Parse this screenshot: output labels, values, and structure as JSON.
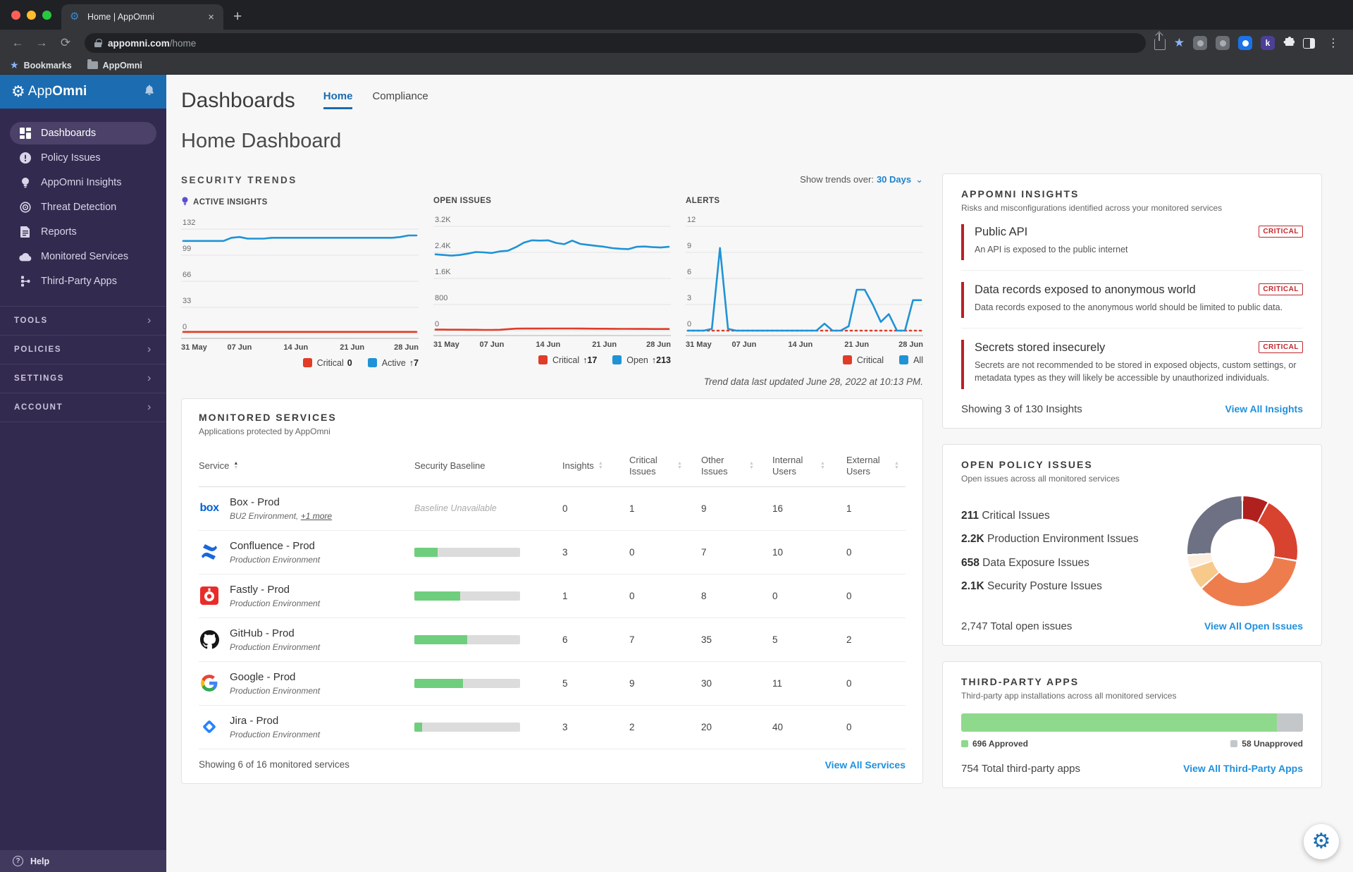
{
  "icons": {
    "back": "←",
    "forward": "→",
    "reload": "⟳",
    "menu": "⋮",
    "plus": "+",
    "close": "×",
    "chevron_down": "⌄",
    "chevron_right": "›",
    "gear": "⚙",
    "star": "★",
    "sort_up": "▲",
    "sort_down": "▼",
    "puzzle": "⬡",
    "k_ext": "k"
  },
  "browser": {
    "tab_title": "Home | AppOmni",
    "url_host": "appomni.com",
    "url_path": "/home",
    "bookmarks_label": "Bookmarks",
    "bookmarks_folder": "AppOmni"
  },
  "sidebar": {
    "logo_prefix": "App",
    "logo_suffix": "Omni",
    "nav": [
      {
        "label": "Dashboards",
        "icon": "dashboards-icon",
        "active": true
      },
      {
        "label": "Policy Issues",
        "icon": "policy-issues-icon",
        "active": false
      },
      {
        "label": "AppOmni Insights",
        "icon": "insights-icon",
        "active": false
      },
      {
        "label": "Threat Detection",
        "icon": "threat-detection-icon",
        "active": false
      },
      {
        "label": "Reports",
        "icon": "reports-icon",
        "active": false
      },
      {
        "label": "Monitored Services",
        "icon": "monitored-services-icon",
        "active": false
      },
      {
        "label": "Third-Party Apps",
        "icon": "third-party-apps-icon",
        "active": false
      }
    ],
    "sections": [
      "TOOLS",
      "POLICIES",
      "SETTINGS",
      "ACCOUNT"
    ],
    "help_label": "Help"
  },
  "header": {
    "title": "Dashboards",
    "tabs": [
      {
        "label": "Home",
        "active": true
      },
      {
        "label": "Compliance",
        "active": false
      }
    ],
    "page_title": "Home Dashboard"
  },
  "trends": {
    "section_title": "SECURITY TRENDS",
    "show_label": "Show trends over:",
    "show_value": "30 Days",
    "updated_note": "Trend data last updated June 28, 2022 at 10:13 PM."
  },
  "chart_data": [
    {
      "type": "line",
      "title": "ACTIVE INSIGHTS",
      "has_bulb_icon": true,
      "ymax": 132,
      "yticks": [
        "132",
        "99",
        "66",
        "33",
        "0"
      ],
      "xticks": [
        "31 May",
        "07 Jun",
        "14 Jun",
        "21 Jun",
        "28 Jun"
      ],
      "series": [
        {
          "name": "Critical",
          "color": "#e03c28",
          "delta": "0",
          "dashed": false,
          "values": [
            2,
            2,
            2,
            2,
            2,
            2,
            2,
            2,
            2,
            2,
            2,
            2,
            2,
            2,
            2,
            2,
            2,
            2,
            2,
            2,
            2,
            2,
            2,
            2,
            2,
            2,
            2,
            2,
            2,
            2
          ]
        },
        {
          "name": "Active",
          "color": "#1f93d6",
          "delta": "↑7",
          "dashed": false,
          "values": [
            117,
            117,
            117,
            117,
            117,
            117,
            121,
            122,
            120,
            120,
            120,
            121,
            121,
            121,
            121,
            121,
            121,
            121,
            121,
            121,
            121,
            121,
            121,
            121,
            121,
            121,
            121,
            122,
            124,
            124
          ]
        }
      ]
    },
    {
      "type": "line",
      "title": "OPEN ISSUES",
      "has_bulb_icon": false,
      "ymax": 3200,
      "yticks": [
        "3.2K",
        "2.4K",
        "1.6K",
        "800",
        "0"
      ],
      "xticks": [
        "31 May",
        "07 Jun",
        "14 Jun",
        "21 Jun",
        "28 Jun"
      ],
      "series": [
        {
          "name": "Critical",
          "color": "#e03c28",
          "delta": "↑17",
          "dashed": false,
          "values": [
            30,
            30,
            28,
            28,
            26,
            25,
            22,
            22,
            25,
            45,
            60,
            62,
            62,
            62,
            64,
            64,
            64,
            64,
            62,
            60,
            58,
            58,
            56,
            55,
            54,
            52,
            52,
            50,
            50,
            50
          ]
        },
        {
          "name": "Open",
          "color": "#1f93d6",
          "delta": "↑213",
          "dashed": false,
          "values": [
            2340,
            2320,
            2300,
            2320,
            2360,
            2410,
            2400,
            2380,
            2430,
            2450,
            2560,
            2700,
            2770,
            2760,
            2770,
            2690,
            2650,
            2760,
            2660,
            2630,
            2600,
            2570,
            2530,
            2510,
            2500,
            2570,
            2580,
            2560,
            2550,
            2570
          ]
        }
      ]
    },
    {
      "type": "line",
      "title": "ALERTS",
      "has_bulb_icon": false,
      "ymax": 12,
      "yticks": [
        "12",
        "9",
        "6",
        "3",
        "0"
      ],
      "xticks": [
        "31 May",
        "07 Jun",
        "14 Jun",
        "21 Jun",
        "28 Jun"
      ],
      "series": [
        {
          "name": "Critical",
          "color": "#e03c28",
          "delta": "",
          "dashed": true,
          "values": [
            0,
            0,
            0,
            0,
            0,
            0,
            0,
            0,
            0,
            0,
            0,
            0,
            0,
            0,
            0,
            0,
            0,
            0,
            0,
            0,
            0,
            0,
            0,
            0,
            0,
            0,
            0,
            0,
            0,
            0
          ]
        },
        {
          "name": "All",
          "color": "#1f93d6",
          "delta": "",
          "dashed": false,
          "values": [
            0,
            0,
            0,
            0.2,
            9.5,
            0.2,
            0,
            0,
            0,
            0,
            0,
            0,
            0,
            0,
            0,
            0,
            0,
            0.8,
            0,
            0,
            0.5,
            4.7,
            4.7,
            3.0,
            1.0,
            1.9,
            0,
            0,
            3.5,
            3.5
          ]
        }
      ]
    },
    {
      "type": "donut",
      "title": "OPEN POLICY ISSUES",
      "total": 2747,
      "slices": [
        {
          "label": "critical",
          "color": "#b0201e",
          "from": 0,
          "to": 28
        },
        {
          "label": "high",
          "color": "#d8432f",
          "from": 28,
          "to": 100
        },
        {
          "label": "medium",
          "color": "#ee7d4e",
          "from": 100,
          "to": 228
        },
        {
          "label": "low",
          "color": "#f7c98b",
          "from": 228,
          "to": 252
        },
        {
          "label": "info",
          "color": "#fdeedd",
          "from": 252,
          "to": 266
        },
        {
          "label": "other",
          "color": "#6e7183",
          "from": 266,
          "to": 360
        }
      ]
    },
    {
      "type": "bar",
      "title": "THIRD-PARTY APPS",
      "categories": [
        "Approved",
        "Unapproved"
      ],
      "values": [
        696,
        58
      ],
      "colors": [
        "#8fd98c",
        "#c4c7ca"
      ]
    }
  ],
  "monitored": {
    "title": "MONITORED SERVICES",
    "subtitle": "Applications protected by AppOmni",
    "columns": [
      {
        "label": "Service",
        "sortable": true,
        "sorted": "asc",
        "wide": false
      },
      {
        "label": "Security Baseline",
        "sortable": false,
        "sorted": "",
        "wide": true
      },
      {
        "label": "Insights",
        "sortable": true,
        "sorted": "",
        "wide": true
      },
      {
        "label": "Critical Issues",
        "sortable": true,
        "sorted": "",
        "wide": false
      },
      {
        "label": "Other Issues",
        "sortable": true,
        "sorted": "",
        "wide": false
      },
      {
        "label": "Internal Users",
        "sortable": true,
        "sorted": "",
        "wide": false
      },
      {
        "label": "External Users",
        "sortable": true,
        "sorted": "",
        "wide": false
      }
    ],
    "rows": [
      {
        "service": "Box - Prod",
        "env": "BU2 Environment,",
        "env_link": "+1 more",
        "icon": "box",
        "baseline": null,
        "baseline_text": "Baseline Unavailable",
        "insights": "0",
        "critical": "1",
        "other": "9",
        "internal": "16",
        "external": "1"
      },
      {
        "service": "Confluence - Prod",
        "env": "Production Environment",
        "env_link": "",
        "icon": "confluence",
        "baseline": 22,
        "baseline_text": "",
        "insights": "3",
        "critical": "0",
        "other": "7",
        "internal": "10",
        "external": "0"
      },
      {
        "service": "Fastly - Prod",
        "env": "Production Environment",
        "env_link": "",
        "icon": "fastly",
        "baseline": 43,
        "baseline_text": "",
        "insights": "1",
        "critical": "0",
        "other": "8",
        "internal": "0",
        "external": "0"
      },
      {
        "service": "GitHub - Prod",
        "env": "Production Environment",
        "env_link": "",
        "icon": "github",
        "baseline": 50,
        "baseline_text": "",
        "insights": "6",
        "critical": "7",
        "other": "35",
        "internal": "5",
        "external": "2"
      },
      {
        "service": "Google - Prod",
        "env": "Production Environment",
        "env_link": "",
        "icon": "google",
        "baseline": 46,
        "baseline_text": "",
        "insights": "5",
        "critical": "9",
        "other": "30",
        "internal": "11",
        "external": "0"
      },
      {
        "service": "Jira - Prod",
        "env": "Production Environment",
        "env_link": "",
        "icon": "jira",
        "baseline": 7,
        "baseline_text": "",
        "insights": "3",
        "critical": "2",
        "other": "20",
        "internal": "40",
        "external": "0"
      }
    ],
    "footer": "Showing 6 of 16 monitored services",
    "view_all": "View All Services"
  },
  "insights_panel": {
    "title": "APPOMNI INSIGHTS",
    "subtitle": "Risks and misconfigurations identified across your monitored services",
    "items": [
      {
        "name": "Public API",
        "desc": "An API is exposed to the public internet",
        "severity": "CRITICAL"
      },
      {
        "name": "Data records exposed to anonymous world",
        "desc": "Data records exposed to the anonymous world should be limited to public data.",
        "severity": "CRITICAL"
      },
      {
        "name": "Secrets stored insecurely",
        "desc": "Secrets are not recommended to be stored in exposed objects, custom settings, or metadata types as they will likely be accessible by unauthorized individuals.",
        "severity": "CRITICAL"
      }
    ],
    "footer": "Showing 3 of 130 Insights",
    "view_all": "View All Insights"
  },
  "policy_panel": {
    "title": "OPEN POLICY ISSUES",
    "subtitle": "Open issues across all monitored services",
    "stats": [
      {
        "value": "211",
        "label": "Critical Issues"
      },
      {
        "value": "2.2K",
        "label": "Production Environment Issues"
      },
      {
        "value": "658",
        "label": "Data Exposure Issues"
      },
      {
        "value": "2.1K",
        "label": "Security Posture Issues"
      }
    ],
    "total": "2,747 Total open issues",
    "view_all": "View All Open Issues"
  },
  "third_party_panel": {
    "title": "THIRD-PARTY APPS",
    "subtitle": "Third-party app installations across all monitored services",
    "approved_label": "696 Approved",
    "unapproved_label": "58 Unapproved",
    "total": "754 Total third-party apps",
    "view_all": "View All Third-Party Apps"
  }
}
